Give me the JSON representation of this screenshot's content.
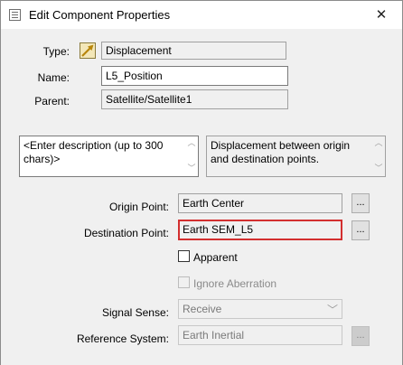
{
  "window": {
    "title": "Edit Component Properties",
    "close_glyph": "✕",
    "icon": "properties-icon"
  },
  "form": {
    "type_label": "Type:",
    "type_value": "Displacement",
    "type_icon": "displacement-arrow-icon",
    "name_label": "Name:",
    "name_value": "L5_Position",
    "parent_label": "Parent:",
    "parent_value": "Satellite/Satellite1",
    "description_placeholder": "<Enter description (up to 300 chars)>",
    "long_description": "Displacement between origin and destination points.",
    "origin_label": "Origin Point:",
    "origin_value": "Earth Center",
    "destination_label": "Destination Point:",
    "destination_value": "Earth SEM_L5",
    "browse_label": "...",
    "apparent_label": "Apparent",
    "apparent_checked": false,
    "ignore_aberration_label": "Ignore Aberration",
    "ignore_aberration_checked": false,
    "signal_sense_label": "Signal Sense:",
    "signal_sense_value": "Receive",
    "reference_system_label": "Reference System:",
    "reference_system_value": "Earth Inertial"
  },
  "colors": {
    "active_border": "#d32f2f",
    "window_bg": "#f0f0f0",
    "type_icon_fill": "#c8a23a"
  }
}
